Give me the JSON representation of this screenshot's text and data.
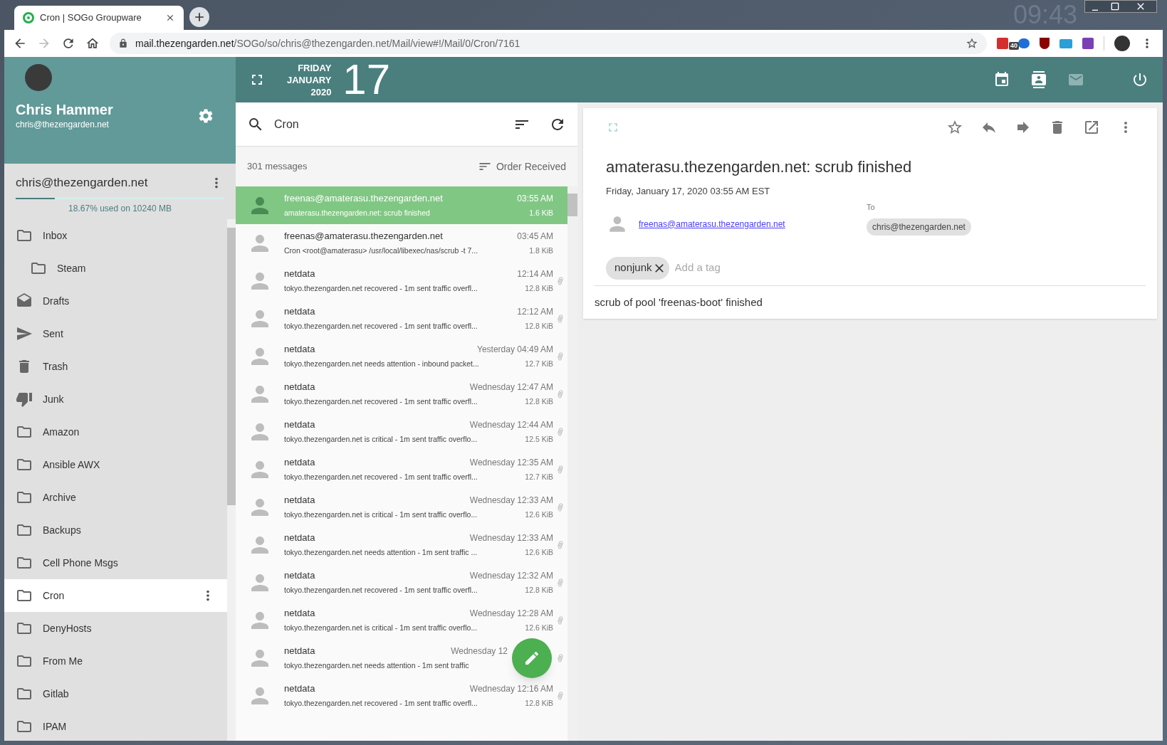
{
  "desktop": {
    "clock": "09:43"
  },
  "browser": {
    "tab_title": "Cron | SOGo Groupware",
    "url_host": "mail.thezengarden.net",
    "url_path": "/SOGo/so/chris@thezengarden.net/Mail/view#!/Mail/0/Cron/7161",
    "extension_badge": "40"
  },
  "user": {
    "name": "Chris Hammer",
    "email": "chris@thezengarden.net"
  },
  "date": {
    "weekday": "FRIDAY",
    "month": "JANUARY",
    "year": "2020",
    "day": "17"
  },
  "account": {
    "name": "chris@thezengarden.net",
    "quota": {
      "level": 0.1867,
      "label": "18.67% used on 10240 MB"
    }
  },
  "folders": [
    {
      "name": "Inbox",
      "kind": "folder",
      "selected": false,
      "children": [
        {
          "name": "Steam",
          "kind": "folder",
          "selected": false
        }
      ]
    },
    {
      "name": "Drafts",
      "kind": "drafts",
      "selected": false
    },
    {
      "name": "Sent",
      "kind": "sent",
      "selected": false
    },
    {
      "name": "Trash",
      "kind": "trash",
      "selected": false
    },
    {
      "name": "Junk",
      "kind": "junk",
      "selected": false
    },
    {
      "name": "Amazon",
      "kind": "folder",
      "selected": false
    },
    {
      "name": "Ansible AWX",
      "kind": "folder",
      "selected": false
    },
    {
      "name": "Archive",
      "kind": "folder",
      "selected": false
    },
    {
      "name": "Backups",
      "kind": "folder",
      "selected": false
    },
    {
      "name": "Cell Phone Msgs",
      "kind": "folder",
      "selected": false
    },
    {
      "name": "Cron",
      "kind": "folder",
      "selected": true
    },
    {
      "name": "DenyHosts",
      "kind": "folder",
      "selected": false
    },
    {
      "name": "From Me",
      "kind": "folder",
      "selected": false
    },
    {
      "name": "Gitlab",
      "kind": "folder",
      "selected": false
    },
    {
      "name": "IPAM",
      "kind": "folder",
      "selected": false
    }
  ],
  "search": {
    "value": "Cron"
  },
  "list": {
    "count": "301 messages",
    "order": "Order Received"
  },
  "messages": [
    {
      "from": "freenas@amaterasu.thezengarden.net",
      "time": "03:55 AM",
      "subject": "amaterasu.thezengarden.net: scrub finished",
      "size": "1.6 KiB",
      "selected": true,
      "attachment": false
    },
    {
      "from": "freenas@amaterasu.thezengarden.net",
      "time": "03:45 AM",
      "subject": "Cron <root@amaterasu> /usr/local/libexec/nas/scrub -t 7...",
      "size": "1.8 KiB",
      "selected": false,
      "attachment": false
    },
    {
      "from": "netdata",
      "time": "12:14 AM",
      "subject": "tokyo.thezengarden.net recovered - 1m sent traffic overfl...",
      "size": "12.8 KiB",
      "selected": false,
      "attachment": true
    },
    {
      "from": "netdata",
      "time": "12:12 AM",
      "subject": "tokyo.thezengarden.net recovered - 1m sent traffic overfl...",
      "size": "12.8 KiB",
      "selected": false,
      "attachment": true
    },
    {
      "from": "netdata",
      "time": "Yesterday 04:49 AM",
      "subject": "tokyo.thezengarden.net needs attention - inbound packet...",
      "size": "12.7 KiB",
      "selected": false,
      "attachment": true
    },
    {
      "from": "netdata",
      "time": "Wednesday 12:47 AM",
      "subject": "tokyo.thezengarden.net recovered - 1m sent traffic overfl...",
      "size": "12.8 KiB",
      "selected": false,
      "attachment": true
    },
    {
      "from": "netdata",
      "time": "Wednesday 12:44 AM",
      "subject": "tokyo.thezengarden.net is critical - 1m sent traffic overflo...",
      "size": "12.5 KiB",
      "selected": false,
      "attachment": true
    },
    {
      "from": "netdata",
      "time": "Wednesday 12:35 AM",
      "subject": "tokyo.thezengarden.net recovered - 1m sent traffic overfl...",
      "size": "12.7 KiB",
      "selected": false,
      "attachment": true
    },
    {
      "from": "netdata",
      "time": "Wednesday 12:33 AM",
      "subject": "tokyo.thezengarden.net is critical - 1m sent traffic overflo...",
      "size": "12.6 KiB",
      "selected": false,
      "attachment": true
    },
    {
      "from": "netdata",
      "time": "Wednesday 12:33 AM",
      "subject": "tokyo.thezengarden.net needs attention - 1m sent traffic ...",
      "size": "12.6 KiB",
      "selected": false,
      "attachment": true
    },
    {
      "from": "netdata",
      "time": "Wednesday 12:32 AM",
      "subject": "tokyo.thezengarden.net recovered - 1m sent traffic overfl...",
      "size": "12.8 KiB",
      "selected": false,
      "attachment": true
    },
    {
      "from": "netdata",
      "time": "Wednesday 12:28 AM",
      "subject": "tokyo.thezengarden.net is critical - 1m sent traffic overflo...",
      "size": "12.6 KiB",
      "selected": false,
      "attachment": true
    },
    {
      "from": "netdata",
      "time": "Wednesday 12",
      "subject": "tokyo.thezengarden.net needs attention - 1m sent traffic",
      "selected": false,
      "attachment": true
    },
    {
      "from": "netdata",
      "time": "Wednesday 12:16 AM",
      "subject": "tokyo.thezengarden.net recovered - 1m sent traffic overfl...",
      "size": "12.8 KiB",
      "selected": false,
      "attachment": true
    }
  ],
  "reader": {
    "subject": "amaterasu.thezengarden.net: scrub finished",
    "date": "Friday, January 17, 2020 03:55 AM EST",
    "from": "freenas@amaterasu.thezengarden.net",
    "to_label": "To",
    "to": [
      "chris@thezengarden.net"
    ],
    "tags": [
      "nonjunk"
    ],
    "tag_placeholder": "Add a tag",
    "body": "scrub of pool 'freenas-boot' finished"
  }
}
